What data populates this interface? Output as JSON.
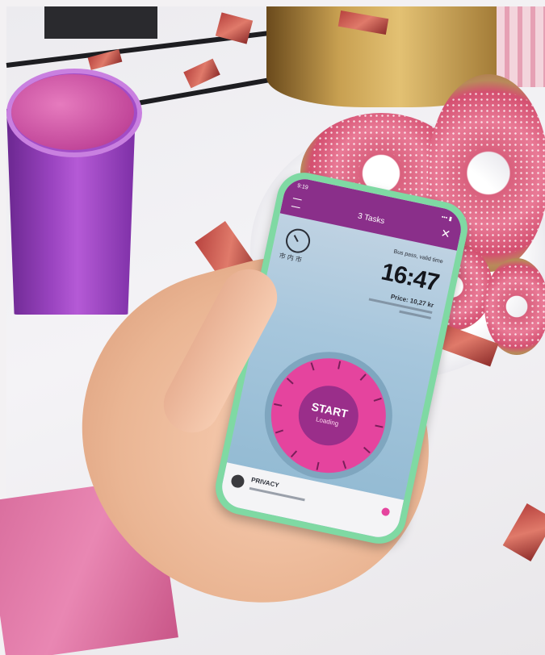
{
  "app": {
    "status_time": "9:19",
    "status_right": "••• ▮",
    "title": "3 Tasks",
    "close_glyph": "✕"
  },
  "ticket": {
    "place_name": "市 内 市",
    "valid_label": "Bus pass, valid time",
    "time": "16:47",
    "price": "Price: 10,27 kr"
  },
  "dial": {
    "start_label": "START",
    "sub_label": "Loading"
  },
  "bottom": {
    "privacy_label": "PRIVACY"
  },
  "colors": {
    "app_purple": "#8a2f8a",
    "dial_pink": "#e5449e",
    "case_green": "#7fd9a3"
  }
}
